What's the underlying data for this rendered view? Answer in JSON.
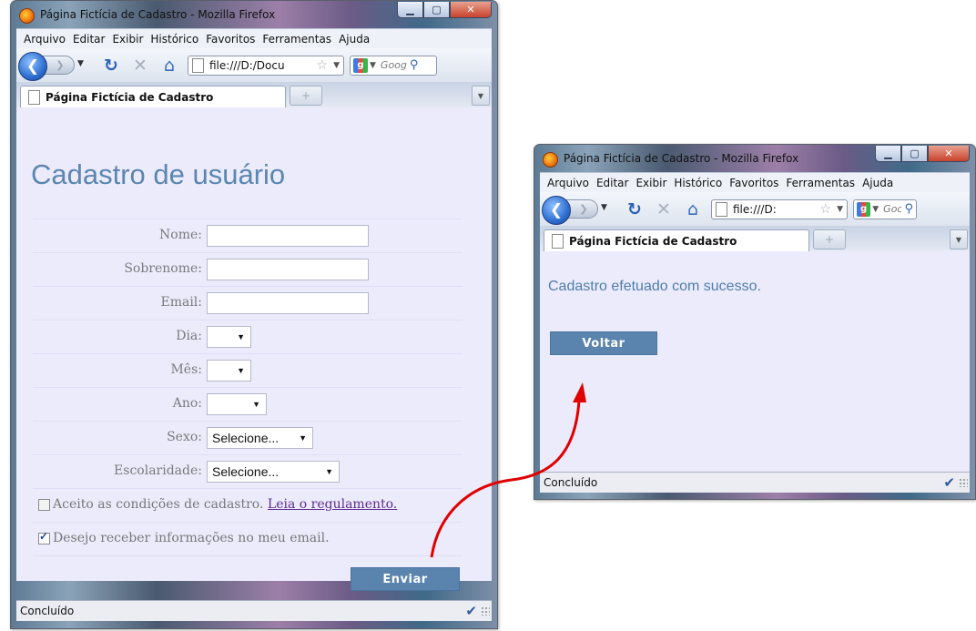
{
  "window1": {
    "title": "Página Fictícia de Cadastro - Mozilla Firefox",
    "menu": [
      "Arquivo",
      "Editar",
      "Exibir",
      "Histórico",
      "Favoritos",
      "Ferramentas",
      "Ajuda"
    ],
    "url": "file:///D:/Docu",
    "search_placeholder": "Goog",
    "tab_label": "Página Fictícia de Cadastro",
    "heading": "Cadastro de usuário",
    "form": {
      "nome_label": "Nome:",
      "sobrenome_label": "Sobrenome:",
      "email_label": "Email:",
      "dia_label": "Dia:",
      "mes_label": "Mês:",
      "ano_label": "Ano:",
      "sexo_label": "Sexo:",
      "sexo_value": "Selecione...",
      "escolaridade_label": "Escolaridade:",
      "escolaridade_value": "Selecione...",
      "terms_label": "Aceito as condições de cadastro.",
      "terms_link": "Leia o regulamento.",
      "newsletter_label": "Desejo receber informações no meu email.",
      "submit_label": "Enviar"
    },
    "status": "Concluído"
  },
  "window2": {
    "title": "Página Fictícia de Cadastro - Mozilla Firefox",
    "menu": [
      "Arquivo",
      "Editar",
      "Exibir",
      "Histórico",
      "Favoritos",
      "Ferramentas",
      "Ajuda"
    ],
    "url": "file:///D:",
    "search_placeholder": "Goc",
    "tab_label": "Página Fictícia de Cadastro",
    "message": "Cadastro efetuado com sucesso.",
    "back_label": "Voltar",
    "status": "Concluído"
  },
  "colors": {
    "page_background": "#ecebfc",
    "heading": "#5b86b0",
    "button": "#5a84ad",
    "arrow": "#e00000"
  }
}
